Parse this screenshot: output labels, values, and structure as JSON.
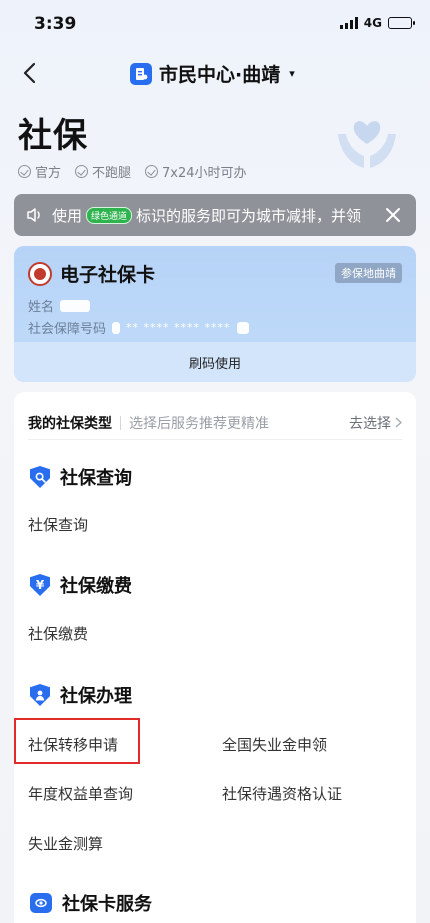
{
  "status_bar": {
    "time": "3:39",
    "network": "4G"
  },
  "nav": {
    "title": "市民中心·曲靖",
    "caret": "▾"
  },
  "page": {
    "title": "社保"
  },
  "tags": [
    "官方",
    "不跑腿",
    "7x24小时可办"
  ],
  "notice": {
    "prefix": "使用",
    "badge": "绿色通道",
    "text": "标识的服务即可为城市减排，并领"
  },
  "social_card": {
    "title": "电子社保卡",
    "badge": "参保地曲靖",
    "name_label": "姓名",
    "id_label": "社会保障号码",
    "id_masked": "** **** **** ****",
    "action": "刷码使用"
  },
  "insurance_type": {
    "label": "我的社保类型",
    "hint": "选择后服务推荐更精准",
    "action": "去选择"
  },
  "sections": [
    {
      "title": "社保查询",
      "icon": "search-shield-icon",
      "items": [
        "社保查询"
      ]
    },
    {
      "title": "社保缴费",
      "icon": "yen-shield-icon",
      "items": [
        "社保缴费"
      ]
    },
    {
      "title": "社保办理",
      "icon": "person-shield-icon",
      "items": [
        "社保转移申请",
        "全国失业金申领",
        "年度权益单查询",
        "社保待遇资格认证",
        "失业金测算"
      ]
    },
    {
      "title": "社保卡服务",
      "icon": "card-icon",
      "items": []
    }
  ],
  "colors": {
    "brand_blue": "#2a6ef0",
    "highlight_red": "#e12a2a",
    "notice_bg": "#8f9399",
    "green_badge": "#2fb34f"
  }
}
